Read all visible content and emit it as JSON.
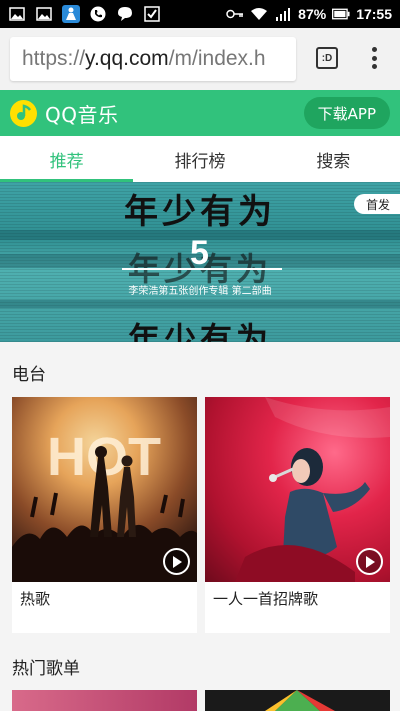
{
  "status_bar": {
    "icons_left": [
      "image-icon",
      "image-icon",
      "person-app-icon",
      "phone-icon",
      "chat-icon",
      "check-icon"
    ],
    "icons_right": [
      "key-icon",
      "wifi-icon",
      "signal-icon",
      "battery-icon"
    ],
    "battery": "87%",
    "time": "17:55"
  },
  "browser": {
    "url_scheme": "https://",
    "url_host": "y.qq.com",
    "url_path": "/m/index.h",
    "tab_count": ":D"
  },
  "header": {
    "brand": "QQ音乐",
    "download_label": "下载APP",
    "colors": {
      "brand_green": "#31c27c",
      "logo_yellow": "#ffe000",
      "button_green": "#1fa55f"
    }
  },
  "tabs": [
    {
      "label": "推荐",
      "active": true
    },
    {
      "label": "排行榜",
      "active": false
    },
    {
      "label": "搜索",
      "active": false
    }
  ],
  "banner": {
    "title_top": "年少有为",
    "title_mid": "年少有为",
    "title_bottom": "年少有为",
    "number": "5",
    "subtitle": "李荣浩第五张创作专辑 第二部曲",
    "badge": "首发"
  },
  "radio": {
    "title": "电台",
    "cards": [
      {
        "label": "热歌",
        "image_text": "HOT"
      },
      {
        "label": "一人一首招牌歌"
      }
    ]
  },
  "hot_playlists": {
    "title": "热门歌单"
  }
}
